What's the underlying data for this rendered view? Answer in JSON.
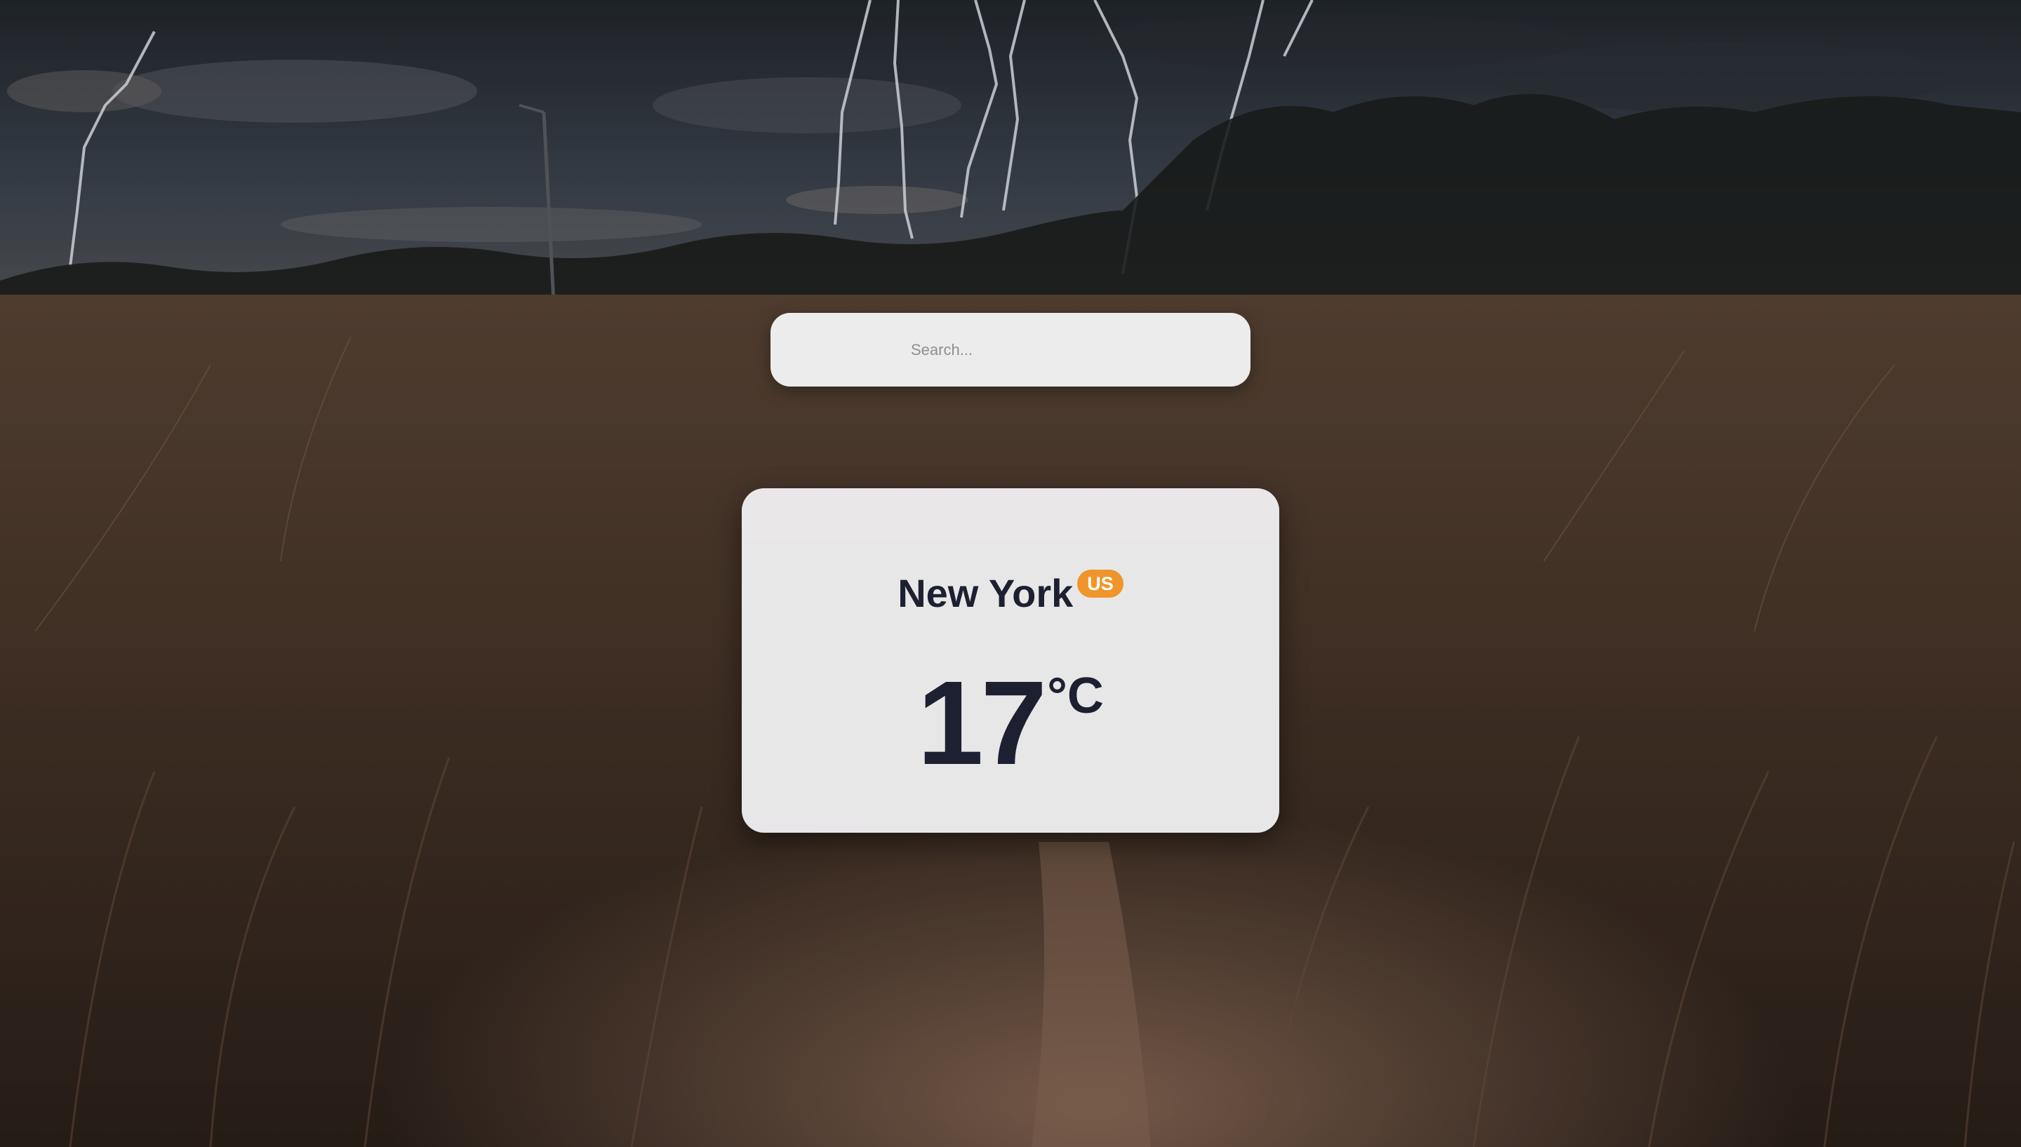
{
  "search": {
    "placeholder": "Search..."
  },
  "weather": {
    "city": "New York",
    "country": "US",
    "temperature": "17",
    "unit": "°C"
  },
  "colors": {
    "badge": "#f0952b",
    "text": "#1c2030",
    "card": "#f5f5f8"
  },
  "background": {
    "description_icon": "stormy-field-background"
  }
}
